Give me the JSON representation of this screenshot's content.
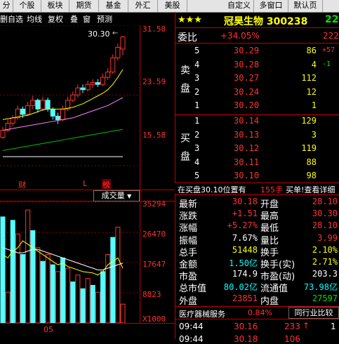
{
  "tabs": [
    "分",
    "个股",
    "板块",
    "期货",
    "基金",
    "外汇",
    "美股",
    "自定义",
    "多窗口",
    "默认页"
  ],
  "toolbar": {
    "items": [
      "删自选",
      "均线",
      "复权",
      "叠",
      "窗",
      "预测"
    ]
  },
  "price_chart": {
    "high_label": "30.30",
    "y_labels": [
      "31.50",
      "23.59",
      "15.58"
    ],
    "markers": [
      {
        "text": "财",
        "color": "#ff3030"
      },
      {
        "text": "L",
        "color": "#ff3030"
      },
      {
        "text": "榜",
        "color": "#ff3030"
      }
    ],
    "volume_title": "成交量",
    "vol_labels": [
      "35294",
      "26470",
      "17647",
      "8823",
      "X1000"
    ],
    "date_label": "05"
  },
  "chart_data": {
    "type": "candlestick",
    "ylim": [
      15.58,
      31.5
    ],
    "candles": [
      {
        "o": 18.8,
        "c": 19.6,
        "h": 20.0,
        "l": 18.6
      },
      {
        "o": 19.6,
        "c": 20.4,
        "h": 20.8,
        "l": 19.4
      },
      {
        "o": 20.4,
        "c": 21.0,
        "h": 21.3,
        "l": 20.1
      },
      {
        "o": 21.0,
        "c": 22.0,
        "h": 22.4,
        "l": 20.8
      },
      {
        "o": 22.0,
        "c": 21.4,
        "h": 22.3,
        "l": 21.0
      },
      {
        "o": 21.4,
        "c": 22.4,
        "h": 22.8,
        "l": 21.2
      },
      {
        "o": 22.4,
        "c": 23.0,
        "h": 23.5,
        "l": 22.0
      },
      {
        "o": 23.0,
        "c": 22.0,
        "h": 23.2,
        "l": 21.6
      },
      {
        "o": 22.0,
        "c": 23.0,
        "h": 23.4,
        "l": 21.8
      },
      {
        "o": 23.0,
        "c": 22.0,
        "h": 23.3,
        "l": 21.7
      },
      {
        "o": 22.0,
        "c": 21.2,
        "h": 22.2,
        "l": 20.8
      },
      {
        "o": 21.2,
        "c": 20.8,
        "h": 21.6,
        "l": 20.3
      },
      {
        "o": 20.8,
        "c": 22.0,
        "h": 22.4,
        "l": 20.6
      },
      {
        "o": 22.0,
        "c": 23.0,
        "h": 23.4,
        "l": 21.8
      },
      {
        "o": 23.0,
        "c": 23.6,
        "h": 24.0,
        "l": 22.8
      },
      {
        "o": 23.6,
        "c": 24.4,
        "h": 24.8,
        "l": 23.3
      },
      {
        "o": 24.4,
        "c": 24.2,
        "h": 24.8,
        "l": 23.8
      },
      {
        "o": 24.2,
        "c": 24.8,
        "h": 25.2,
        "l": 24.0
      },
      {
        "o": 24.8,
        "c": 25.0,
        "h": 25.4,
        "l": 24.4
      },
      {
        "o": 25.0,
        "c": 24.8,
        "h": 25.4,
        "l": 24.5
      },
      {
        "o": 24.8,
        "c": 25.6,
        "h": 26.0,
        "l": 24.6
      },
      {
        "o": 25.6,
        "c": 26.2,
        "h": 26.6,
        "l": 25.3
      },
      {
        "o": 26.2,
        "c": 27.8,
        "h": 28.2,
        "l": 26.0
      },
      {
        "o": 27.8,
        "c": 29.0,
        "h": 29.4,
        "l": 27.5
      },
      {
        "o": 28.8,
        "c": 30.18,
        "h": 30.3,
        "l": 28.1
      }
    ],
    "ma": [
      {
        "color": "#ffff00",
        "values": [
          20.8,
          20.9,
          21.0,
          21.1,
          21.2,
          21.3,
          21.5,
          21.7,
          21.9,
          22.0,
          22.0,
          22.0,
          22.0,
          22.1,
          22.2,
          22.4,
          22.6,
          22.9,
          23.2,
          23.5,
          23.8,
          24.2,
          24.8,
          25.6,
          26.5
        ]
      },
      {
        "color": "#ff80ff",
        "values": [
          19.6,
          19.7,
          19.8,
          19.9,
          20.0,
          20.1,
          20.2,
          20.3,
          20.4,
          20.5,
          20.6,
          20.7,
          20.8,
          20.9,
          21.0,
          21.2,
          21.4,
          21.6,
          21.8,
          22.0,
          22.2,
          22.4,
          22.7,
          23.0,
          23.3
        ]
      },
      {
        "color": "#00c000",
        "values": [
          17.3,
          17.4,
          17.5,
          17.6,
          17.7,
          17.8,
          17.9,
          18.0,
          18.1,
          18.2,
          18.3,
          18.4,
          18.5,
          18.6,
          18.7,
          18.8,
          18.9,
          19.0,
          19.1,
          19.2,
          19.3,
          19.4,
          19.5,
          19.6,
          19.7
        ]
      },
      {
        "color": "#ffffff",
        "values": [
          16.6,
          16.6,
          16.6,
          16.6,
          16.6,
          16.6,
          16.6,
          16.6,
          16.6,
          16.6,
          16.6,
          16.6,
          16.6,
          16.6,
          16.6,
          16.6,
          16.6,
          16.6,
          16.6,
          16.6,
          16.6,
          16.6,
          16.6,
          16.6,
          16.6
        ]
      }
    ],
    "volume": {
      "ylim": [
        0,
        35294
      ],
      "unit": "X1000",
      "bars": [
        {
          "v": 31000,
          "up": false
        },
        {
          "v": 9000,
          "up": true
        },
        {
          "v": 30000,
          "up": false
        },
        {
          "v": 26000,
          "up": true
        },
        {
          "v": 20000,
          "up": false
        },
        {
          "v": 33000,
          "up": true
        },
        {
          "v": 27000,
          "up": false
        },
        {
          "v": 22000,
          "up": true
        },
        {
          "v": 18000,
          "up": false
        },
        {
          "v": 20000,
          "up": true
        },
        {
          "v": 17000,
          "up": false
        },
        {
          "v": 15000,
          "up": true
        },
        {
          "v": 19000,
          "up": false
        },
        {
          "v": 16000,
          "up": true
        },
        {
          "v": 12000,
          "up": false
        },
        {
          "v": 14000,
          "up": true
        },
        {
          "v": 10000,
          "up": false
        },
        {
          "v": 13000,
          "up": true
        },
        {
          "v": 11000,
          "up": false
        },
        {
          "v": 9000,
          "up": true
        },
        {
          "v": 15000,
          "up": false
        },
        {
          "v": 20000,
          "up": true
        },
        {
          "v": 25000,
          "up": false
        },
        {
          "v": 28000,
          "up": true
        },
        {
          "v": 5500,
          "up": true
        }
      ],
      "ma": [
        {
          "color": "#ffff00",
          "values": [
            20000,
            19000,
            21000,
            22000,
            24000,
            23000,
            22000,
            21000,
            20000,
            19000,
            18000,
            17000,
            17500,
            16500,
            16000,
            15500,
            15000,
            14800,
            14600,
            14000,
            15000,
            17000,
            18000,
            19000,
            16000
          ]
        },
        {
          "color": "#ffffff",
          "values": [
            22000,
            21500,
            21000,
            20500,
            20500,
            21000,
            21500,
            21500,
            21000,
            20500,
            20000,
            19500,
            19000,
            18500,
            18000,
            17500,
            17000,
            16500,
            16000,
            15500,
            15500,
            16000,
            16500,
            17000,
            17500
          ]
        }
      ]
    }
  },
  "stock": {
    "stars": "★★★",
    "name_code": "冠昊生物 300238",
    "right_num": "22",
    "weibi_label": "委比",
    "weibi_value": "+34.05%",
    "weibi_right": "222",
    "sell_label": "卖盘",
    "buy_label": "买盘",
    "sell_levels": [
      {
        "n": "5",
        "price": "30.29",
        "vol": "86",
        "chg": "+57"
      },
      {
        "n": "4",
        "price": "30.28",
        "vol": "4",
        "chg": "-1"
      },
      {
        "n": "3",
        "price": "30.27",
        "vol": "112",
        "chg": ""
      },
      {
        "n": "2",
        "price": "30.24",
        "vol": "12",
        "chg": ""
      },
      {
        "n": "1",
        "price": "30.20",
        "vol": "1",
        "chg": ""
      }
    ],
    "buy_levels": [
      {
        "n": "1",
        "price": "30.14",
        "vol": "129",
        "chg": ""
      },
      {
        "n": "2",
        "price": "30.13",
        "vol": "3",
        "chg": ""
      },
      {
        "n": "3",
        "price": "30.12",
        "vol": "119",
        "chg": ""
      },
      {
        "n": "4",
        "price": "30.11",
        "vol": "88",
        "chg": ""
      },
      {
        "n": "5",
        "price": "30.10",
        "vol": "98",
        "chg": ""
      }
    ],
    "ticker_left": "在买盘30.10位置有",
    "ticker_qty": "155手",
    "ticker_right": "买单!查看详细",
    "stats": [
      {
        "l1": "最新",
        "v1": "30.18",
        "c1": "red",
        "l2": "开盘",
        "v2": "28.10",
        "c2": "red"
      },
      {
        "l1": "涨跌",
        "v1": "+1.51",
        "c1": "red",
        "l2": "最高",
        "v2": "30.30",
        "c2": "red"
      },
      {
        "l1": "涨幅",
        "v1": "+5.27%",
        "c1": "red",
        "l2": "最低",
        "v2": "28.10",
        "c2": "red"
      },
      {
        "l1": "振幅",
        "v1": "7.67%",
        "c1": "white",
        "l2": "量比",
        "v2": "3.99",
        "c2": "red"
      },
      {
        "l1": "总手",
        "v1": "51448",
        "c1": "yellow",
        "l2": "换手",
        "v2": "2.10%",
        "c2": "yellow"
      },
      {
        "l1": "金额",
        "v1": "1.50亿",
        "c1": "cyan",
        "l2": "换手(实)",
        "v2": "2.71%",
        "c2": "yellow"
      },
      {
        "l1": "市盈",
        "v1": "174.9",
        "c1": "white",
        "l2": "市盈(动)",
        "v2": "203.3",
        "c2": "white"
      },
      {
        "l1": "总市值",
        "v1": "80.02亿",
        "c1": "cyan",
        "l2": "流通值",
        "v2": "73.98亿",
        "c2": "cyan"
      },
      {
        "l1": "外盘",
        "v1": "23851",
        "c1": "red",
        "l2": "内盘",
        "v2": "27597",
        "c2": "green"
      }
    ],
    "sector_name": "医疗器械服务",
    "sector_pct": "0.84%",
    "compare_btn": "同行业比较",
    "trade_time": "09:44",
    "trade_price": "30.16",
    "trade_vol": "233",
    "trade_num": "1",
    "trade2_time": "09:44",
    "trade2_price": "30.18",
    "trade2_vol": "106"
  }
}
